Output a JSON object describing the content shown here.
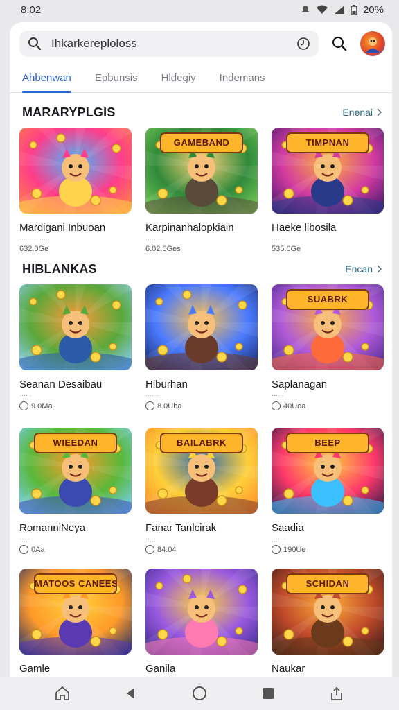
{
  "status": {
    "time": "8:02",
    "battery": "20%"
  },
  "search": {
    "query": "Ihkarkereploloss"
  },
  "tabs": [
    {
      "label": "Ahbenwan"
    },
    {
      "label": "Epbunsis"
    },
    {
      "label": "Hldegiy"
    },
    {
      "label": "Indemans"
    }
  ],
  "sections": [
    {
      "title": "MARARYPLGIS",
      "see_more": "Enenai",
      "cards": [
        {
          "title": "Mardigani Inbuoan",
          "sub": "··· ····· ·····",
          "meta": "632.0Ge",
          "art": "cat-party"
        },
        {
          "title": "Karpinanhalopkiain",
          "sub": "····· ···",
          "meta": "6.02.0Ges",
          "art": "forest-hero"
        },
        {
          "title": "Haeke libosila",
          "sub": "···· ··",
          "meta": "535.0Ge",
          "art": "arcade-hero"
        }
      ]
    },
    {
      "title": "HIBLANKAS",
      "see_more": "Encan",
      "cards": [
        {
          "title": "Seanan Desaibau",
          "sub": "···· ·",
          "meta": "9.0Ma",
          "art": "runner"
        },
        {
          "title": "Hiburhan",
          "sub": "···· ··",
          "meta": "8.0Uba",
          "art": "cat-warrior"
        },
        {
          "title": "Saplanagan",
          "sub": "···· ·",
          "meta": "40Uoa",
          "art": "cat-girl"
        }
      ]
    },
    {
      "title": "",
      "see_more": "",
      "cards": [
        {
          "title": "RomanniNeya",
          "sub": "·····",
          "meta": "0Aa",
          "art": "boy-bear"
        },
        {
          "title": "Fanar Tanlcirak",
          "sub": "·····",
          "meta": "84.04",
          "art": "treasure-man"
        },
        {
          "title": "Saadia",
          "sub": "····· ·",
          "meta": "190Ue",
          "art": "blocks"
        }
      ]
    },
    {
      "title": "",
      "see_more": "",
      "cards": [
        {
          "title": "Gamle",
          "sub": "",
          "meta": "",
          "art": "coins"
        },
        {
          "title": "Ganila",
          "sub": "",
          "meta": "",
          "art": "purple-cat"
        },
        {
          "title": "Naukar",
          "sub": "",
          "meta": "",
          "art": "girl-treasure"
        }
      ]
    }
  ],
  "logo_texts": {
    "forest-hero": "GAMEBAND",
    "arcade-hero": "TIMPNAN",
    "cat-girl": "SUABRK",
    "boy-bear": "WIEEDAN",
    "treasure-man": "BAILABRK",
    "blocks": "BEEP",
    "coins": "MATOOS CANEES",
    "purple-cat": "",
    "girl-treasure": "SCHIDAN"
  },
  "icons": {
    "search": "search-icon",
    "history": "clock-icon",
    "chevron": "chevron-right-icon",
    "nav": [
      "home-icon",
      "back-icon",
      "circle-home-icon",
      "square-recents-icon",
      "share-icon"
    ]
  },
  "colors": {
    "accent": "#2a5fd0",
    "link": "#2a6a8a"
  }
}
